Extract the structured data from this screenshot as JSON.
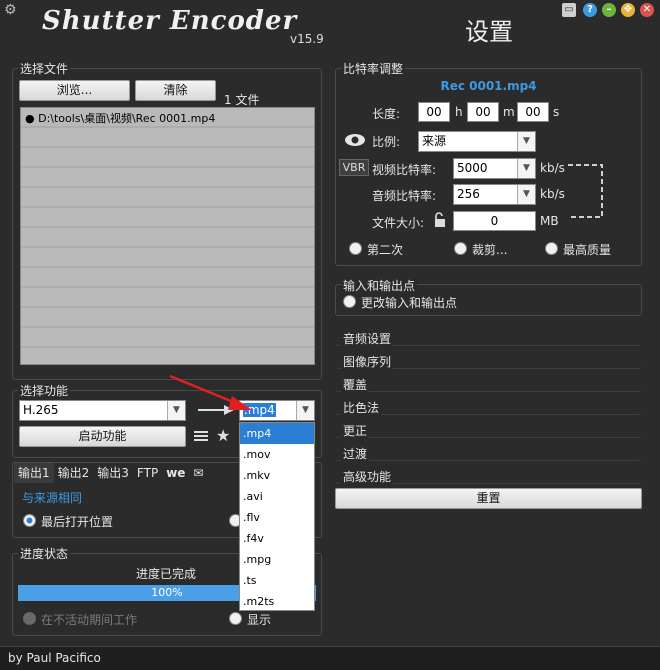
{
  "app": {
    "title": "Shutter Encoder",
    "version": "v15.9",
    "settings_title": "设置",
    "footer": "by Paul Pacifico"
  },
  "window_buttons": [
    {
      "name": "minimize-icon",
      "symbol": "▭",
      "color": "#cfcfcf"
    },
    {
      "name": "help-icon",
      "symbol": "?",
      "color": "#3e9ae0"
    },
    {
      "name": "minimize-green-icon",
      "symbol": "–",
      "color": "#6db33f"
    },
    {
      "name": "maximize-icon",
      "symbol": "✥",
      "color": "#e8b23a"
    },
    {
      "name": "close-icon",
      "symbol": "✕",
      "color": "#d9534f"
    }
  ],
  "file_panel": {
    "title": "选择文件",
    "browse_label": "浏览...",
    "clear_label": "清除",
    "count_label": "1 文件",
    "files": [
      "D:\\tools\\桌面\\视频\\Rec 0001.mp4"
    ]
  },
  "function_panel": {
    "title": "选择功能",
    "codec": "H.265",
    "container": ".mp4",
    "start_label": "启动功能",
    "container_options": [
      ".mp4",
      ".mov",
      ".mkv",
      ".avi",
      ".flv",
      ".f4v",
      ".mpg",
      ".ts",
      ".m2ts"
    ]
  },
  "output_panel": {
    "tabs": [
      "输出1",
      "输出2",
      "输出3",
      "FTP"
    ],
    "same_as_source": "与来源相同",
    "last_open_location": "最后打开位置"
  },
  "progress_panel": {
    "title": "进度状态",
    "status": "进度已完成",
    "percent": 100,
    "percent_label": "100%",
    "work_when_idle": "在不活动期间工作",
    "show": "显示"
  },
  "bitrate_panel": {
    "title": "比特率调整",
    "filename": "Rec 0001.mp4",
    "length_label": "长度:",
    "hours": "00",
    "h": "h",
    "minutes": "00",
    "m": "m",
    "seconds": "00",
    "s": "s",
    "ratio_label": "比例:",
    "ratio_value": "来源",
    "vbr_label": "VBR",
    "video_bitrate_label": "视频比特率:",
    "video_bitrate": "5000",
    "audio_bitrate_label": "音频比特率:",
    "audio_bitrate": "256",
    "kbs": "kb/s",
    "filesize_label": "文件大小:",
    "filesize": "0",
    "mb": "MB",
    "second_pass": "第二次",
    "crop": "裁剪...",
    "best_quality": "最高质量"
  },
  "io_panel": {
    "title": "输入和输出点",
    "change_label": "更改输入和输出点"
  },
  "sections": [
    "音频设置",
    "图像序列",
    "覆盖",
    "比色法",
    "更正",
    "过渡",
    "高级功能"
  ],
  "reset_label": "重置",
  "colors": {
    "background": "#2b2b2b",
    "accent": "#2a7fd4",
    "progress": "#4a9fe8",
    "link": "#3e9ae0"
  }
}
